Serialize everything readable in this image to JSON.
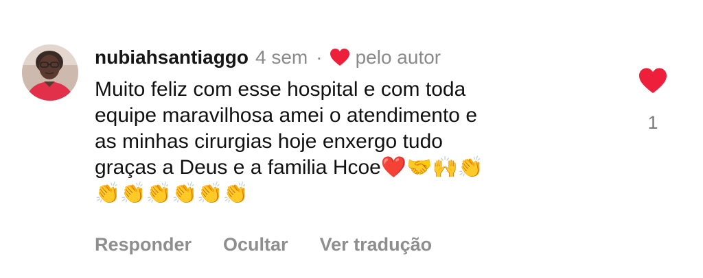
{
  "comment": {
    "username": "nubiahsantiaggo",
    "time": "4 sem",
    "separator": "·",
    "liked_by_author_label": "pelo autor",
    "text_lines": [
      "Muito feliz com esse hospital e com toda",
      "equipe maravilhosa amei o atendimento e",
      "as minhas cirurgias hoje enxergo tudo",
      "graças a Deus e a familia Hcoe"
    ],
    "text_emojis_line4": "❤️🤝🙌👏",
    "text_emojis_line5": "👏👏👏👏👏👏",
    "like_count": "1",
    "actions": {
      "reply": "Responder",
      "hide": "Ocultar",
      "translate": "Ver tradução"
    }
  },
  "colors": {
    "heart_red": "#ed1f3a",
    "muted_gray": "#8a8a8a",
    "text": "#111111"
  },
  "icons": {
    "avatar": "user-avatar",
    "author_like": "heart-icon",
    "like_button": "heart-filled-icon"
  }
}
